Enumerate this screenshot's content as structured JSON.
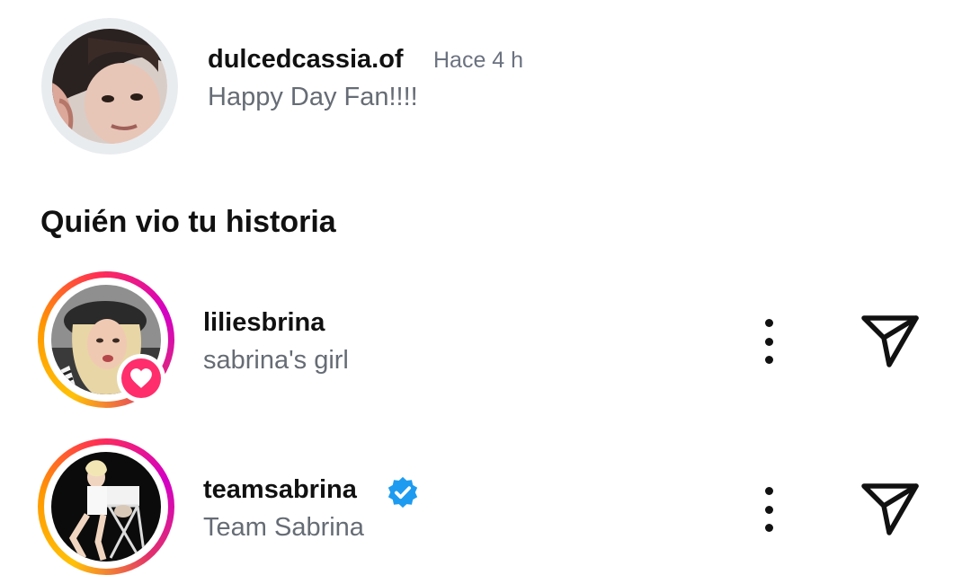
{
  "story": {
    "username": "dulcedcassia.of",
    "time": "Hace 4 h",
    "caption": "Happy Day Fan!!!!"
  },
  "section_title": "Quién vio tu historia",
  "viewers": [
    {
      "username": "liliesbrina",
      "subtitle": "sabrina's girl",
      "verified": false,
      "liked": true
    },
    {
      "username": "teamsabrina",
      "subtitle": "Team Sabrina",
      "verified": true,
      "liked": false
    }
  ],
  "colors": {
    "heart_badge": "#ff2d6b",
    "verified_badge": "#1d9bf0",
    "story_ring": "#e9ecef"
  },
  "icons": {
    "more": "kebab-vertical",
    "send": "paper-plane",
    "liked": "heart",
    "verified": "verified-check"
  }
}
